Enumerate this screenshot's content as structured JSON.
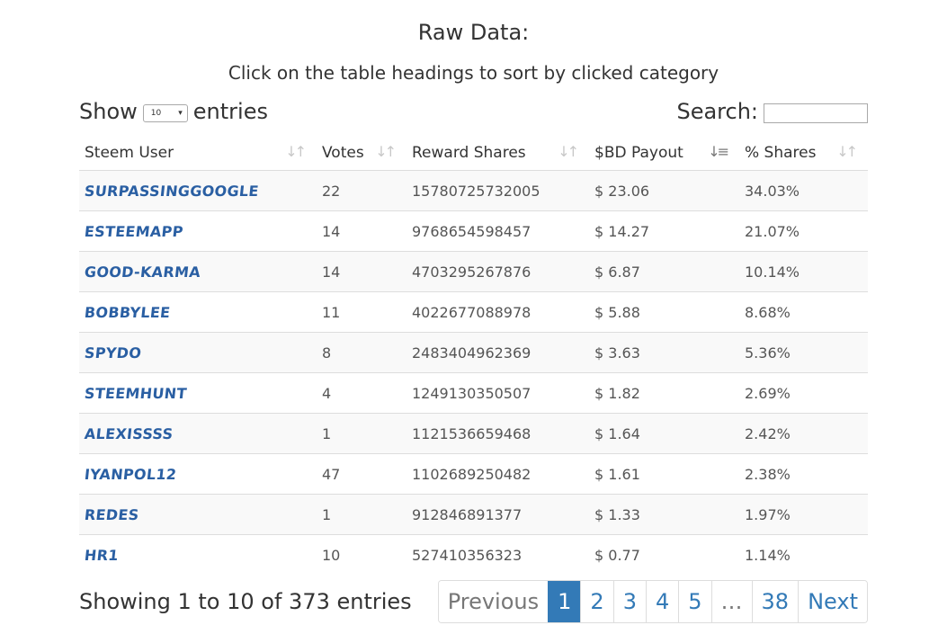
{
  "header": {
    "title": "Raw Data:",
    "subtitle": "Click on the table headings to sort by clicked category"
  },
  "length_control": {
    "prefix": "Show",
    "value": "10",
    "suffix": "entries"
  },
  "search": {
    "label": "Search:",
    "value": ""
  },
  "table": {
    "columns": [
      "Steem User",
      "Votes",
      "Reward Shares",
      "$BD Payout",
      "% Shares"
    ],
    "sorted_column": "$BD Payout",
    "sort_direction": "descending",
    "rows": [
      {
        "user": "SURPASSINGGOOGLE",
        "votes": "22",
        "rshares": "15780725732005",
        "payout": "$ 23.06",
        "share": "34.03%"
      },
      {
        "user": "ESTEEMAPP",
        "votes": "14",
        "rshares": "9768654598457",
        "payout": "$ 14.27",
        "share": "21.07%"
      },
      {
        "user": "GOOD-KARMA",
        "votes": "14",
        "rshares": "4703295267876",
        "payout": "$ 6.87",
        "share": "10.14%"
      },
      {
        "user": "BOBBYLEE",
        "votes": "11",
        "rshares": "4022677088978",
        "payout": "$ 5.88",
        "share": "8.68%"
      },
      {
        "user": "SPYDO",
        "votes": "8",
        "rshares": "2483404962369",
        "payout": "$ 3.63",
        "share": "5.36%"
      },
      {
        "user": "STEEMHUNT",
        "votes": "4",
        "rshares": "1249130350507",
        "payout": "$ 1.82",
        "share": "2.69%"
      },
      {
        "user": "ALEXISSSS",
        "votes": "1",
        "rshares": "1121536659468",
        "payout": "$ 1.64",
        "share": "2.42%"
      },
      {
        "user": "IYANPOL12",
        "votes": "47",
        "rshares": "1102689250482",
        "payout": "$ 1.61",
        "share": "2.38%"
      },
      {
        "user": "REDES",
        "votes": "1",
        "rshares": "912846891377",
        "payout": "$ 1.33",
        "share": "1.97%"
      },
      {
        "user": "HR1",
        "votes": "10",
        "rshares": "527410356323",
        "payout": "$ 0.77",
        "share": "1.14%"
      }
    ]
  },
  "footer": {
    "info": "Showing 1 to 10 of 373 entries",
    "pagination": {
      "previous": "Previous",
      "pages": [
        "1",
        "2",
        "3",
        "4",
        "5"
      ],
      "ellipsis": "…",
      "last_page": "38",
      "next": "Next",
      "current": "1"
    }
  },
  "colors": {
    "link": "#2a5fa3",
    "accent": "#337ab7",
    "row_stripe": "#f9f9f9"
  },
  "icons": {
    "sort_both": "sort-both-icon",
    "sort_desc": "sort-descending-icon"
  }
}
